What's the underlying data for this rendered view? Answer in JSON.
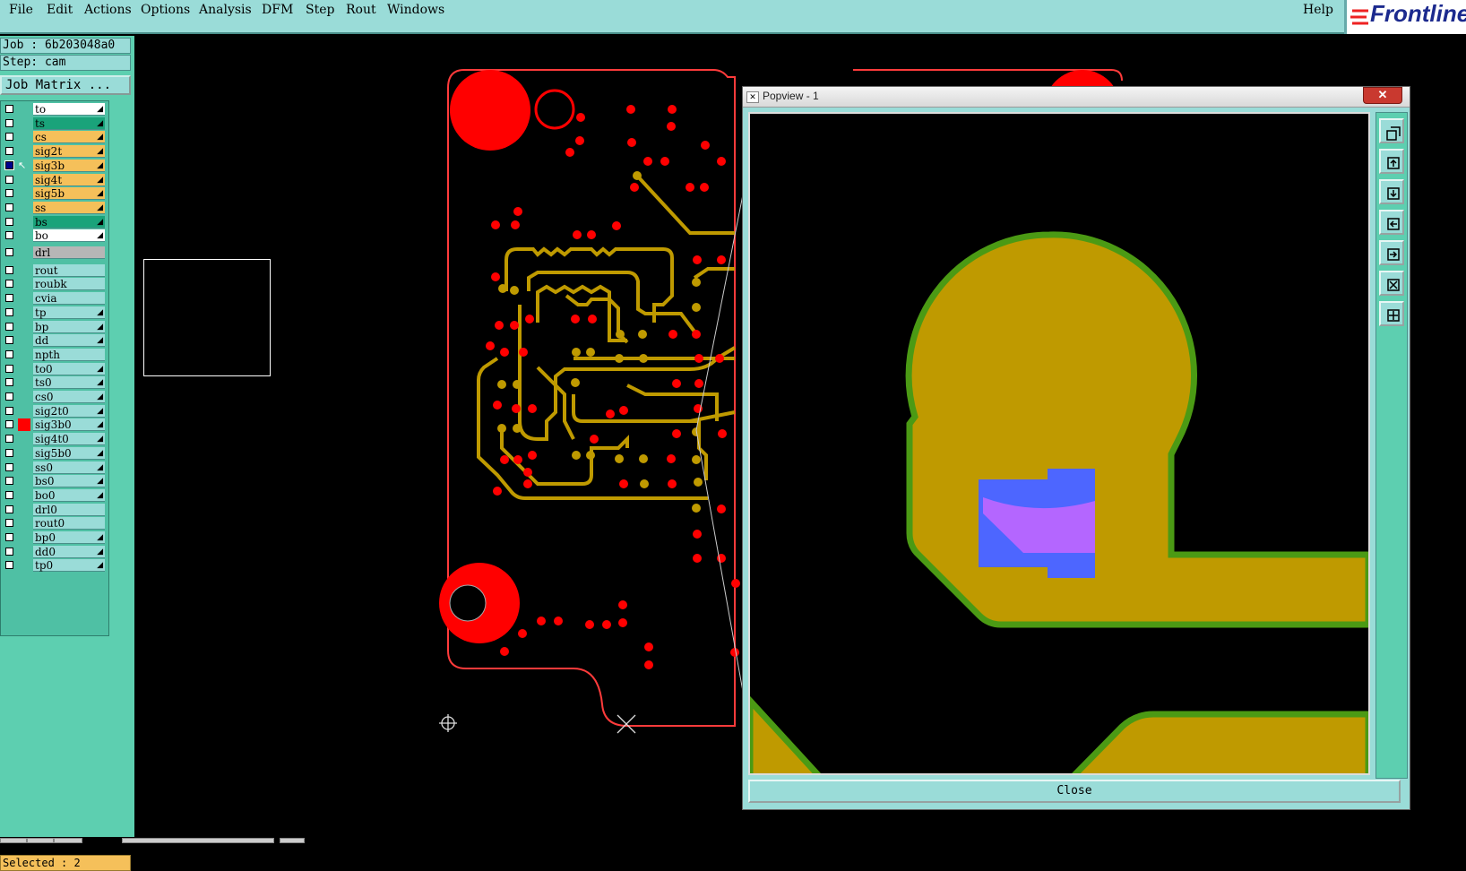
{
  "menu": {
    "items": [
      "File",
      "Edit",
      "Actions",
      "Options",
      "Analysis",
      "DFM",
      "Step",
      "Rout",
      "Windows"
    ],
    "help": "Help"
  },
  "logo": {
    "text": "Frontline"
  },
  "left_panel": {
    "job": "Job : 6b203048a0",
    "step": "Step: cam",
    "job_matrix": "Job Matrix ...",
    "selected": "Selected : 2"
  },
  "layers": [
    {
      "name": "to",
      "color": "#ffffff",
      "checked": false,
      "arrow": true
    },
    {
      "name": "ts",
      "color": "#1aa37a",
      "checked": false,
      "arrow": true
    },
    {
      "name": "cs",
      "color": "#f5c05a",
      "checked": false,
      "arrow": true
    },
    {
      "name": "sig2t",
      "color": "#f5c05a",
      "checked": false,
      "arrow": true
    },
    {
      "name": "sig3b",
      "color": "#f5c05a",
      "checked": true,
      "arrow": true,
      "work": true
    },
    {
      "name": "sig4t",
      "color": "#f5c05a",
      "checked": false,
      "arrow": true
    },
    {
      "name": "sig5b",
      "color": "#f5c05a",
      "checked": false,
      "arrow": true
    },
    {
      "name": "ss",
      "color": "#f5c05a",
      "checked": false,
      "arrow": true
    },
    {
      "name": "bs",
      "color": "#1aa37a",
      "checked": false,
      "arrow": true
    },
    {
      "name": "bo",
      "color": "#ffffff",
      "checked": false,
      "arrow": true
    },
    {
      "name": "drl",
      "color": "#b6b6b6",
      "checked": false,
      "arrow": false
    },
    {
      "name": "rout",
      "color": "#9adcd8",
      "checked": false,
      "arrow": false
    },
    {
      "name": "roubk",
      "color": "#9adcd8",
      "checked": false,
      "arrow": false
    },
    {
      "name": "cvia",
      "color": "#9adcd8",
      "checked": false,
      "arrow": false
    },
    {
      "name": "tp",
      "color": "#9adcd8",
      "checked": false,
      "arrow": true
    },
    {
      "name": "bp",
      "color": "#9adcd8",
      "checked": false,
      "arrow": true
    },
    {
      "name": "dd",
      "color": "#9adcd8",
      "checked": false,
      "arrow": true
    },
    {
      "name": "npth",
      "color": "#9adcd8",
      "checked": false,
      "arrow": false
    },
    {
      "name": "to0",
      "color": "#9adcd8",
      "checked": false,
      "arrow": true
    },
    {
      "name": "ts0",
      "color": "#9adcd8",
      "checked": false,
      "arrow": true
    },
    {
      "name": "cs0",
      "color": "#9adcd8",
      "checked": false,
      "arrow": true
    },
    {
      "name": "sig2t0",
      "color": "#9adcd8",
      "checked": false,
      "arrow": true
    },
    {
      "name": "sig3b0",
      "color": "#9adcd8",
      "checked": false,
      "arrow": true,
      "active": true
    },
    {
      "name": "sig4t0",
      "color": "#9adcd8",
      "checked": false,
      "arrow": true
    },
    {
      "name": "sig5b0",
      "color": "#9adcd8",
      "checked": false,
      "arrow": true
    },
    {
      "name": "ss0",
      "color": "#9adcd8",
      "checked": false,
      "arrow": true
    },
    {
      "name": "bs0",
      "color": "#9adcd8",
      "checked": false,
      "arrow": true
    },
    {
      "name": "bo0",
      "color": "#9adcd8",
      "checked": false,
      "arrow": true
    },
    {
      "name": "drl0",
      "color": "#9adcd8",
      "checked": false,
      "arrow": false
    },
    {
      "name": "rout0",
      "color": "#9adcd8",
      "checked": false,
      "arrow": false
    },
    {
      "name": "bp0",
      "color": "#9adcd8",
      "checked": false,
      "arrow": true
    },
    {
      "name": "dd0",
      "color": "#9adcd8",
      "checked": false,
      "arrow": true
    },
    {
      "name": "tp0",
      "color": "#9adcd8",
      "checked": false,
      "arrow": true
    }
  ],
  "popview": {
    "title": "Popview - 1",
    "close_x": "✕",
    "close_button": "Close",
    "tools": [
      "copy-view-icon",
      "page-up-icon",
      "page-down-icon",
      "page-left-icon",
      "page-right-icon",
      "zoom-fit-icon",
      "zoom-home-icon"
    ]
  },
  "colors": {
    "pad_red": "#ff0000",
    "trace_gold": "#bf9a00",
    "outline_green": "#4b9a14",
    "select_blue": "#4d66ff",
    "select_violet": "#b466ff",
    "board_outline": "#ff3b3b"
  }
}
